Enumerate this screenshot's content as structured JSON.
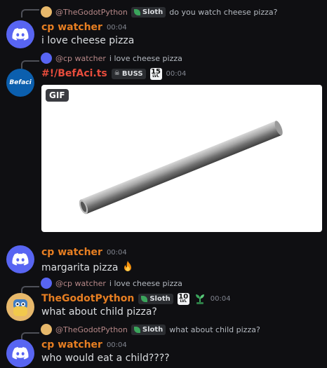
{
  "messages": [
    {
      "reply": {
        "name": "@TheGodotPython",
        "tag": "Sloth",
        "text": "do you watch cheese pizza?"
      },
      "author": "cp watcher",
      "time": "00:04",
      "text": "i love cheese pizza"
    },
    {
      "reply": {
        "name": "@cp watcher",
        "text": "i love cheese pizza"
      },
      "author": "#!/BefAci.ts",
      "tag": "BUSS",
      "level": "15",
      "level_sub": "LVL",
      "time": "00:04",
      "avatar_text": "Befaci",
      "gif_badge": "GIF"
    },
    {
      "author": "cp watcher",
      "time": "00:04",
      "text": "margarita pizza"
    },
    {
      "reply": {
        "name": "@cp watcher",
        "text": "i love cheese pizza"
      },
      "author": "TheGodotPython",
      "tag": "Sloth",
      "level": "10",
      "level_sub": "LVL",
      "time": "00:04",
      "text": "what about child pizza?"
    },
    {
      "reply": {
        "name": "@TheGodotPython",
        "tag": "Sloth",
        "text": "what about child pizza?"
      },
      "author": "cp watcher",
      "time": "00:04",
      "text": "who would eat a child????"
    }
  ],
  "colors": {
    "background": "#0f0f12",
    "username_orange": "#e67e22",
    "username_red": "#e74c3c",
    "discord_blurple": "#5865f2"
  }
}
